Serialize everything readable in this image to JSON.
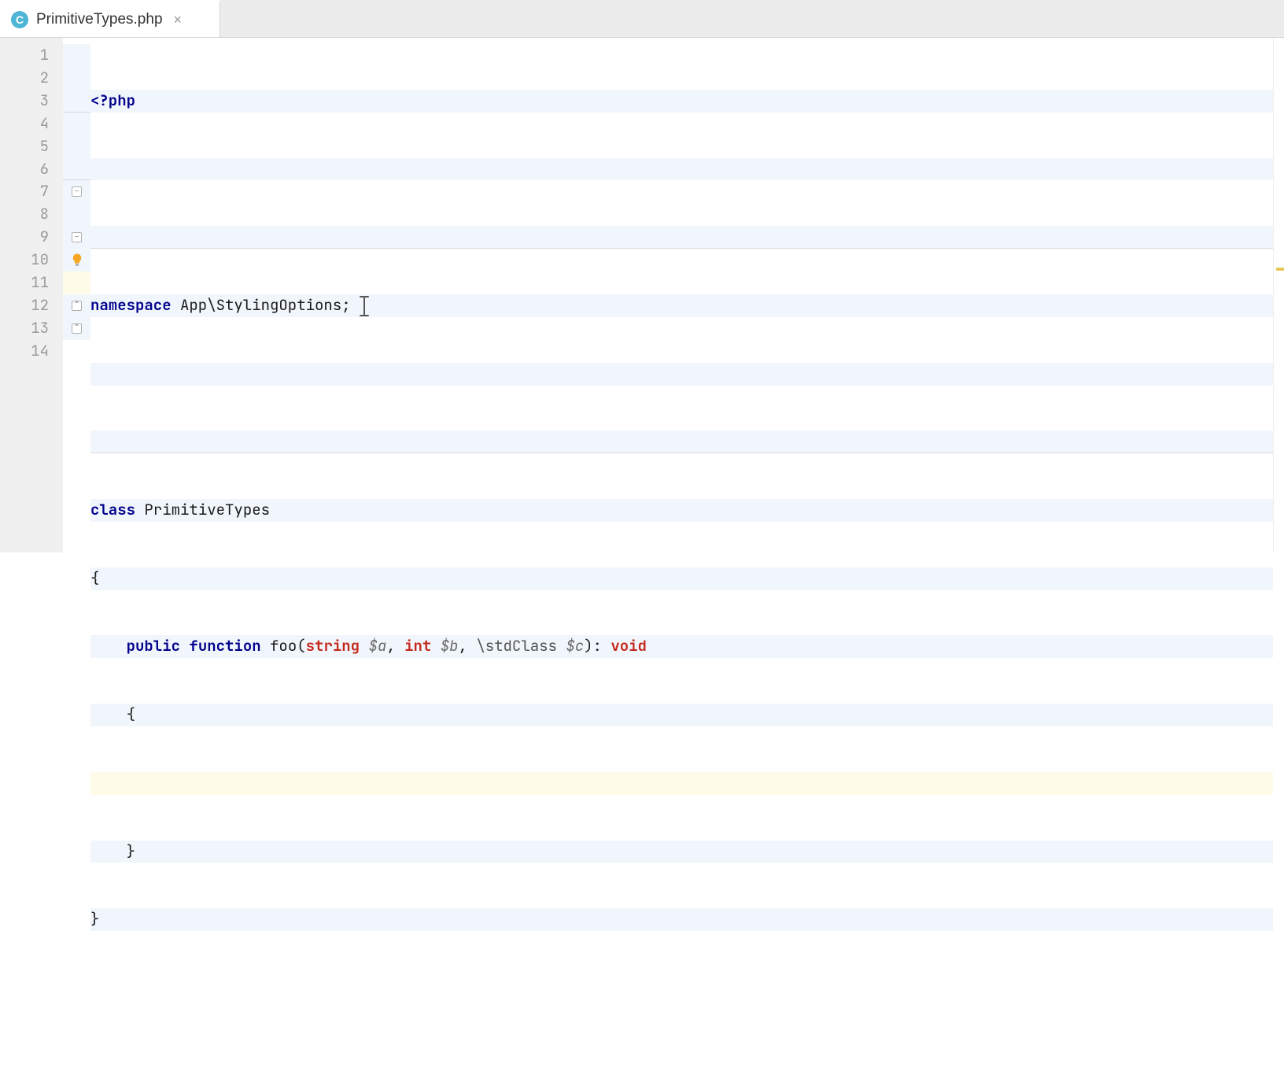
{
  "tab": {
    "file_icon_letter": "C",
    "filename": "PrimitiveTypes.php",
    "close_glyph": "×"
  },
  "gutter": {
    "lines": [
      "1",
      "2",
      "3",
      "4",
      "5",
      "6",
      "7",
      "8",
      "9",
      "10",
      "11",
      "12",
      "13",
      "14"
    ]
  },
  "code": {
    "l1": {
      "open": "<?php"
    },
    "l4": {
      "kw": "namespace",
      "rest": " App\\StylingOptions;"
    },
    "l7": {
      "kw": "class",
      "rest": " PrimitiveTypes"
    },
    "l8": {
      "brace": "{"
    },
    "l9": {
      "indent": "    ",
      "kw_public": "public",
      "sp1": " ",
      "kw_function": "function",
      "sp2": " ",
      "fn": "foo",
      "paren_o": "(",
      "t_string": "string",
      "sp3": " ",
      "v_a": "$a",
      "comma1": ", ",
      "t_int": "int",
      "sp4": " ",
      "v_b": "$b",
      "comma2": ", ",
      "t_std": "\\stdClass",
      "sp5": " ",
      "v_c": "$c",
      "paren_c": ")",
      "colon": ": ",
      "t_void": "void"
    },
    "l10": {
      "indent": "    ",
      "brace": "{"
    },
    "l11": {
      "indent": "        "
    },
    "l12": {
      "indent": "    ",
      "brace": "}"
    },
    "l13": {
      "brace": "}"
    }
  },
  "fold": {
    "minus": "−",
    "end": "⌃"
  }
}
